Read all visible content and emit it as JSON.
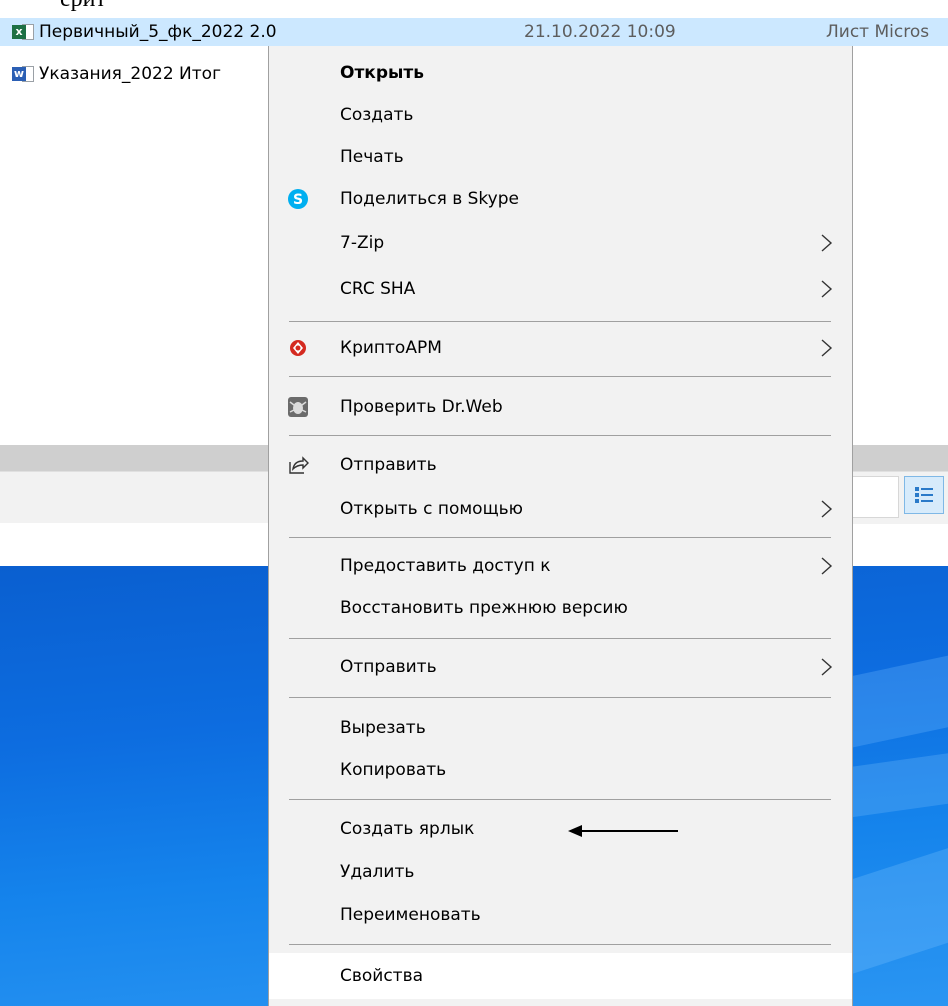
{
  "files": [
    {
      "name": "Первичный_5_фк_2022 2.0",
      "date": "21.10.2022 10:09",
      "type": "Лист Micros",
      "icon": "excel-icon"
    },
    {
      "name": "Указания_2022 Итог",
      "icon": "word-icon"
    }
  ],
  "menu": {
    "open": "Открыть",
    "create": "Создать",
    "print": "Печать",
    "skype": "Поделиться в Skype",
    "zip": "7-Zip",
    "crc": "CRC SHA",
    "cryptoarm": "КриптоАРМ",
    "drweb": "Проверить Dr.Web",
    "send_share": "Отправить",
    "open_with": "Открыть с помощью",
    "grant_access": "Предоставить доступ к",
    "restore": "Восстановить прежнюю версию",
    "send_to": "Отправить",
    "cut": "Вырезать",
    "copy": "Копировать",
    "shortcut": "Создать ярлык",
    "delete": "Удалить",
    "rename": "Переименовать",
    "properties": "Свойства"
  },
  "colors": {
    "selection": "#cce8ff",
    "menu_bg": "#f2f2f2",
    "desktop_blue": "#0d6de0",
    "skype_blue": "#00aff0",
    "cryptoarm_red": "#d42a20"
  }
}
